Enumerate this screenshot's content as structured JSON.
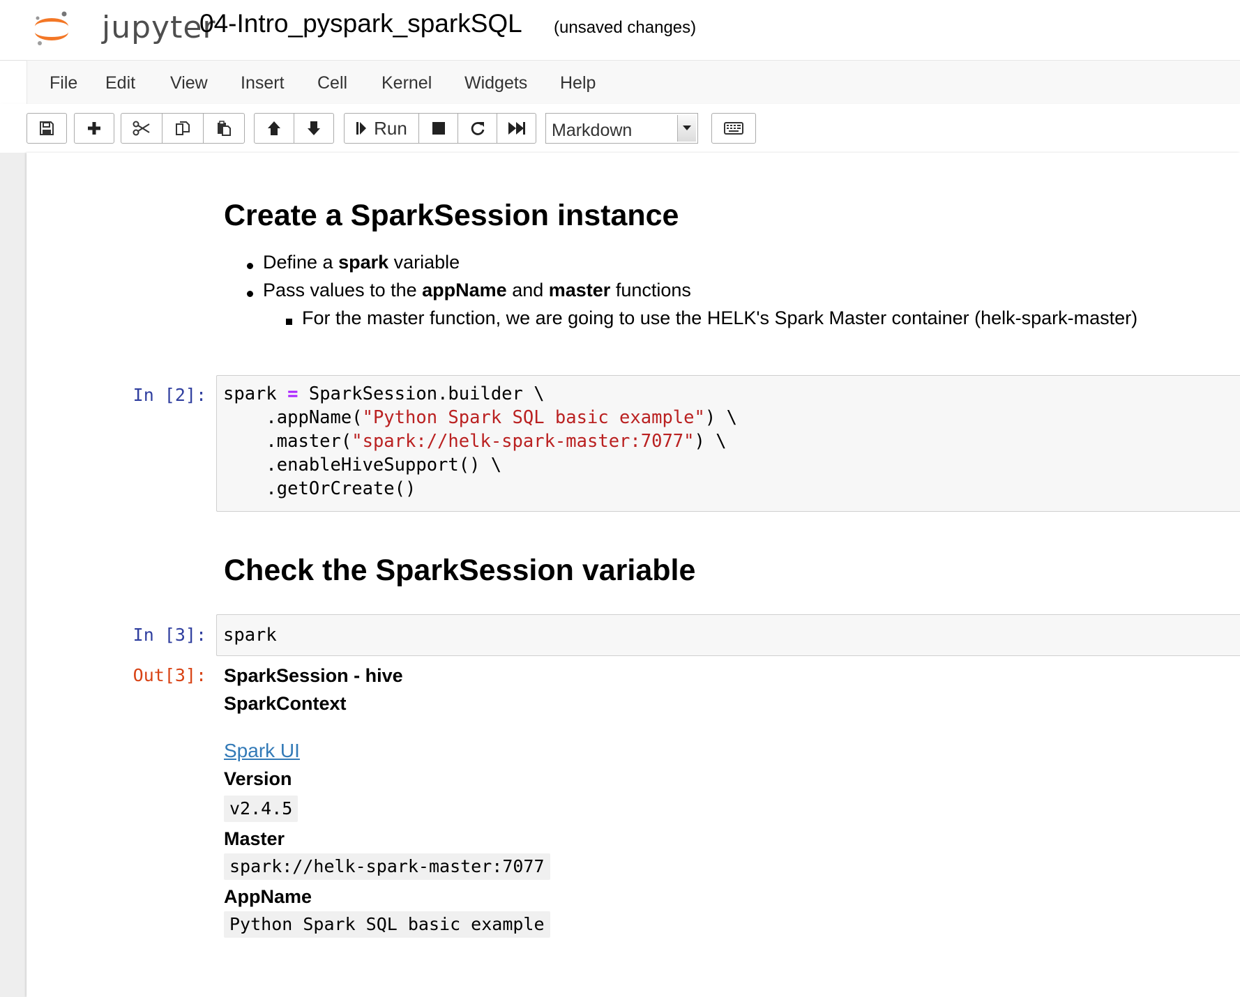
{
  "header": {
    "logo_text": "jupyter",
    "notebook_title": "04-Intro_pyspark_sparkSQL",
    "save_status": "(unsaved changes)"
  },
  "menubar": {
    "items": [
      "File",
      "Edit",
      "View",
      "Insert",
      "Cell",
      "Kernel",
      "Widgets",
      "Help"
    ]
  },
  "toolbar": {
    "buttons": [
      {
        "icon": "save-icon"
      },
      {
        "icon": "plus-icon"
      },
      {
        "icon": "cut-icon"
      },
      {
        "icon": "copy-icon"
      },
      {
        "icon": "paste-icon"
      },
      {
        "icon": "arrow-up-icon"
      },
      {
        "icon": "arrow-down-icon"
      },
      {
        "icon": "step-forward-icon",
        "label": "Run"
      },
      {
        "icon": "stop-icon"
      },
      {
        "icon": "restart-icon"
      },
      {
        "icon": "fast-forward-icon"
      },
      {
        "icon": "keyboard-icon"
      }
    ],
    "run_label": "Run",
    "cell_type": "Markdown"
  },
  "cells": {
    "md1": {
      "heading": "Create a SparkSession instance",
      "item1": {
        "pre": "Define a ",
        "bold": "spark",
        "post": " variable"
      },
      "item2": {
        "pre": "Pass values to the ",
        "bold1": "appName",
        "mid": " and ",
        "bold2": "master",
        "post": " functions"
      },
      "subitem": "For the master function, we are going to use the HELK's Spark Master container (helk-spark-master)"
    },
    "code2": {
      "prompt": "In [2]:",
      "lines": [
        {
          "a": "spark ",
          "op": "=",
          "b": " SparkSession.builder \\"
        },
        {
          "a": "    .appName(",
          "str": "\"Python Spark SQL basic example\"",
          "b": ") \\"
        },
        {
          "a": "    .master(",
          "str": "\"spark://helk-spark-master:7077\"",
          "b": ") \\"
        },
        {
          "a": "    .enableHiveSupport() \\"
        },
        {
          "a": "    .getOrCreate()"
        }
      ]
    },
    "md2": {
      "heading": "Check the SparkSession variable"
    },
    "code3": {
      "prompt": "In [3]:",
      "source": "spark",
      "out_prompt": "Out[3]:",
      "output": {
        "session": "SparkSession - hive",
        "context": "SparkContext",
        "spark_ui_link": "Spark UI",
        "version_label": "Version",
        "version_value": "v2.4.5",
        "master_label": "Master",
        "master_value": "spark://helk-spark-master:7077",
        "appname_label": "AppName",
        "appname_value": "Python Spark SQL basic example"
      }
    }
  },
  "colors": {
    "prompt_in": "#303f9f",
    "prompt_out": "#d84315",
    "string": "#ba2121",
    "operator": "#aa22ff",
    "link": "#337ab7",
    "logo_orange": "#f37726"
  }
}
